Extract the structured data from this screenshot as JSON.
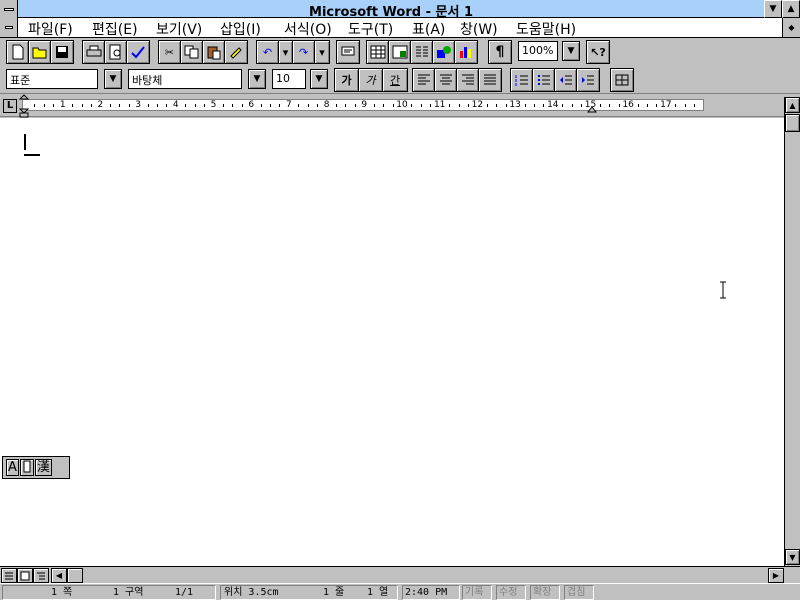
{
  "window": {
    "title": "Microsoft Word - 문서 1"
  },
  "menu": [
    {
      "label": "파일(F)"
    },
    {
      "label": "편집(E)"
    },
    {
      "label": "보기(V)"
    },
    {
      "label": "삽입(I)"
    },
    {
      "label": "서식(O)"
    },
    {
      "label": "도구(T)"
    },
    {
      "label": "표(A)"
    },
    {
      "label": "창(W)"
    },
    {
      "label": "도움말(H)"
    }
  ],
  "toolbar": {
    "zoom": "100%",
    "buttons": [
      "new-icon",
      "open-icon",
      "save-icon",
      "print-icon",
      "print-preview-icon",
      "spelling-icon",
      "cut-icon",
      "copy-icon",
      "paste-icon",
      "format-painter-icon",
      "undo-icon",
      "redo-icon",
      "autoformat-icon",
      "insert-table-icon",
      "insert-excel-icon",
      "columns-icon",
      "drawing-icon",
      "chart-icon",
      "show-marks-icon",
      "help-icon"
    ]
  },
  "formatting": {
    "style": "표준",
    "font": "바탕체",
    "size": "10",
    "bold": "가",
    "italic": "가",
    "underline": "간"
  },
  "ruler": {
    "tab_selector": "L",
    "numbers": [
      "1",
      "2",
      "3",
      "4",
      "5",
      "6",
      "7",
      "8",
      "9",
      "10",
      "11",
      "12",
      "13",
      "14",
      "15",
      "16",
      "17"
    ]
  },
  "ime": {
    "mode1": "A",
    "mode2": "漢"
  },
  "status": {
    "page": "1 쪽",
    "section": "1 구역",
    "page_of": "1/1",
    "position": "위치 3.5cm",
    "line": "1 줄",
    "column": "1 열",
    "time": "2:40 PM",
    "rec": "기록",
    "mrk": "수정",
    "ext": "확장",
    "ovr": "겹침"
  },
  "colors": {
    "titlebar": "#a8d0f8",
    "chrome": "#c0c0c0",
    "document": "#ffffff"
  }
}
